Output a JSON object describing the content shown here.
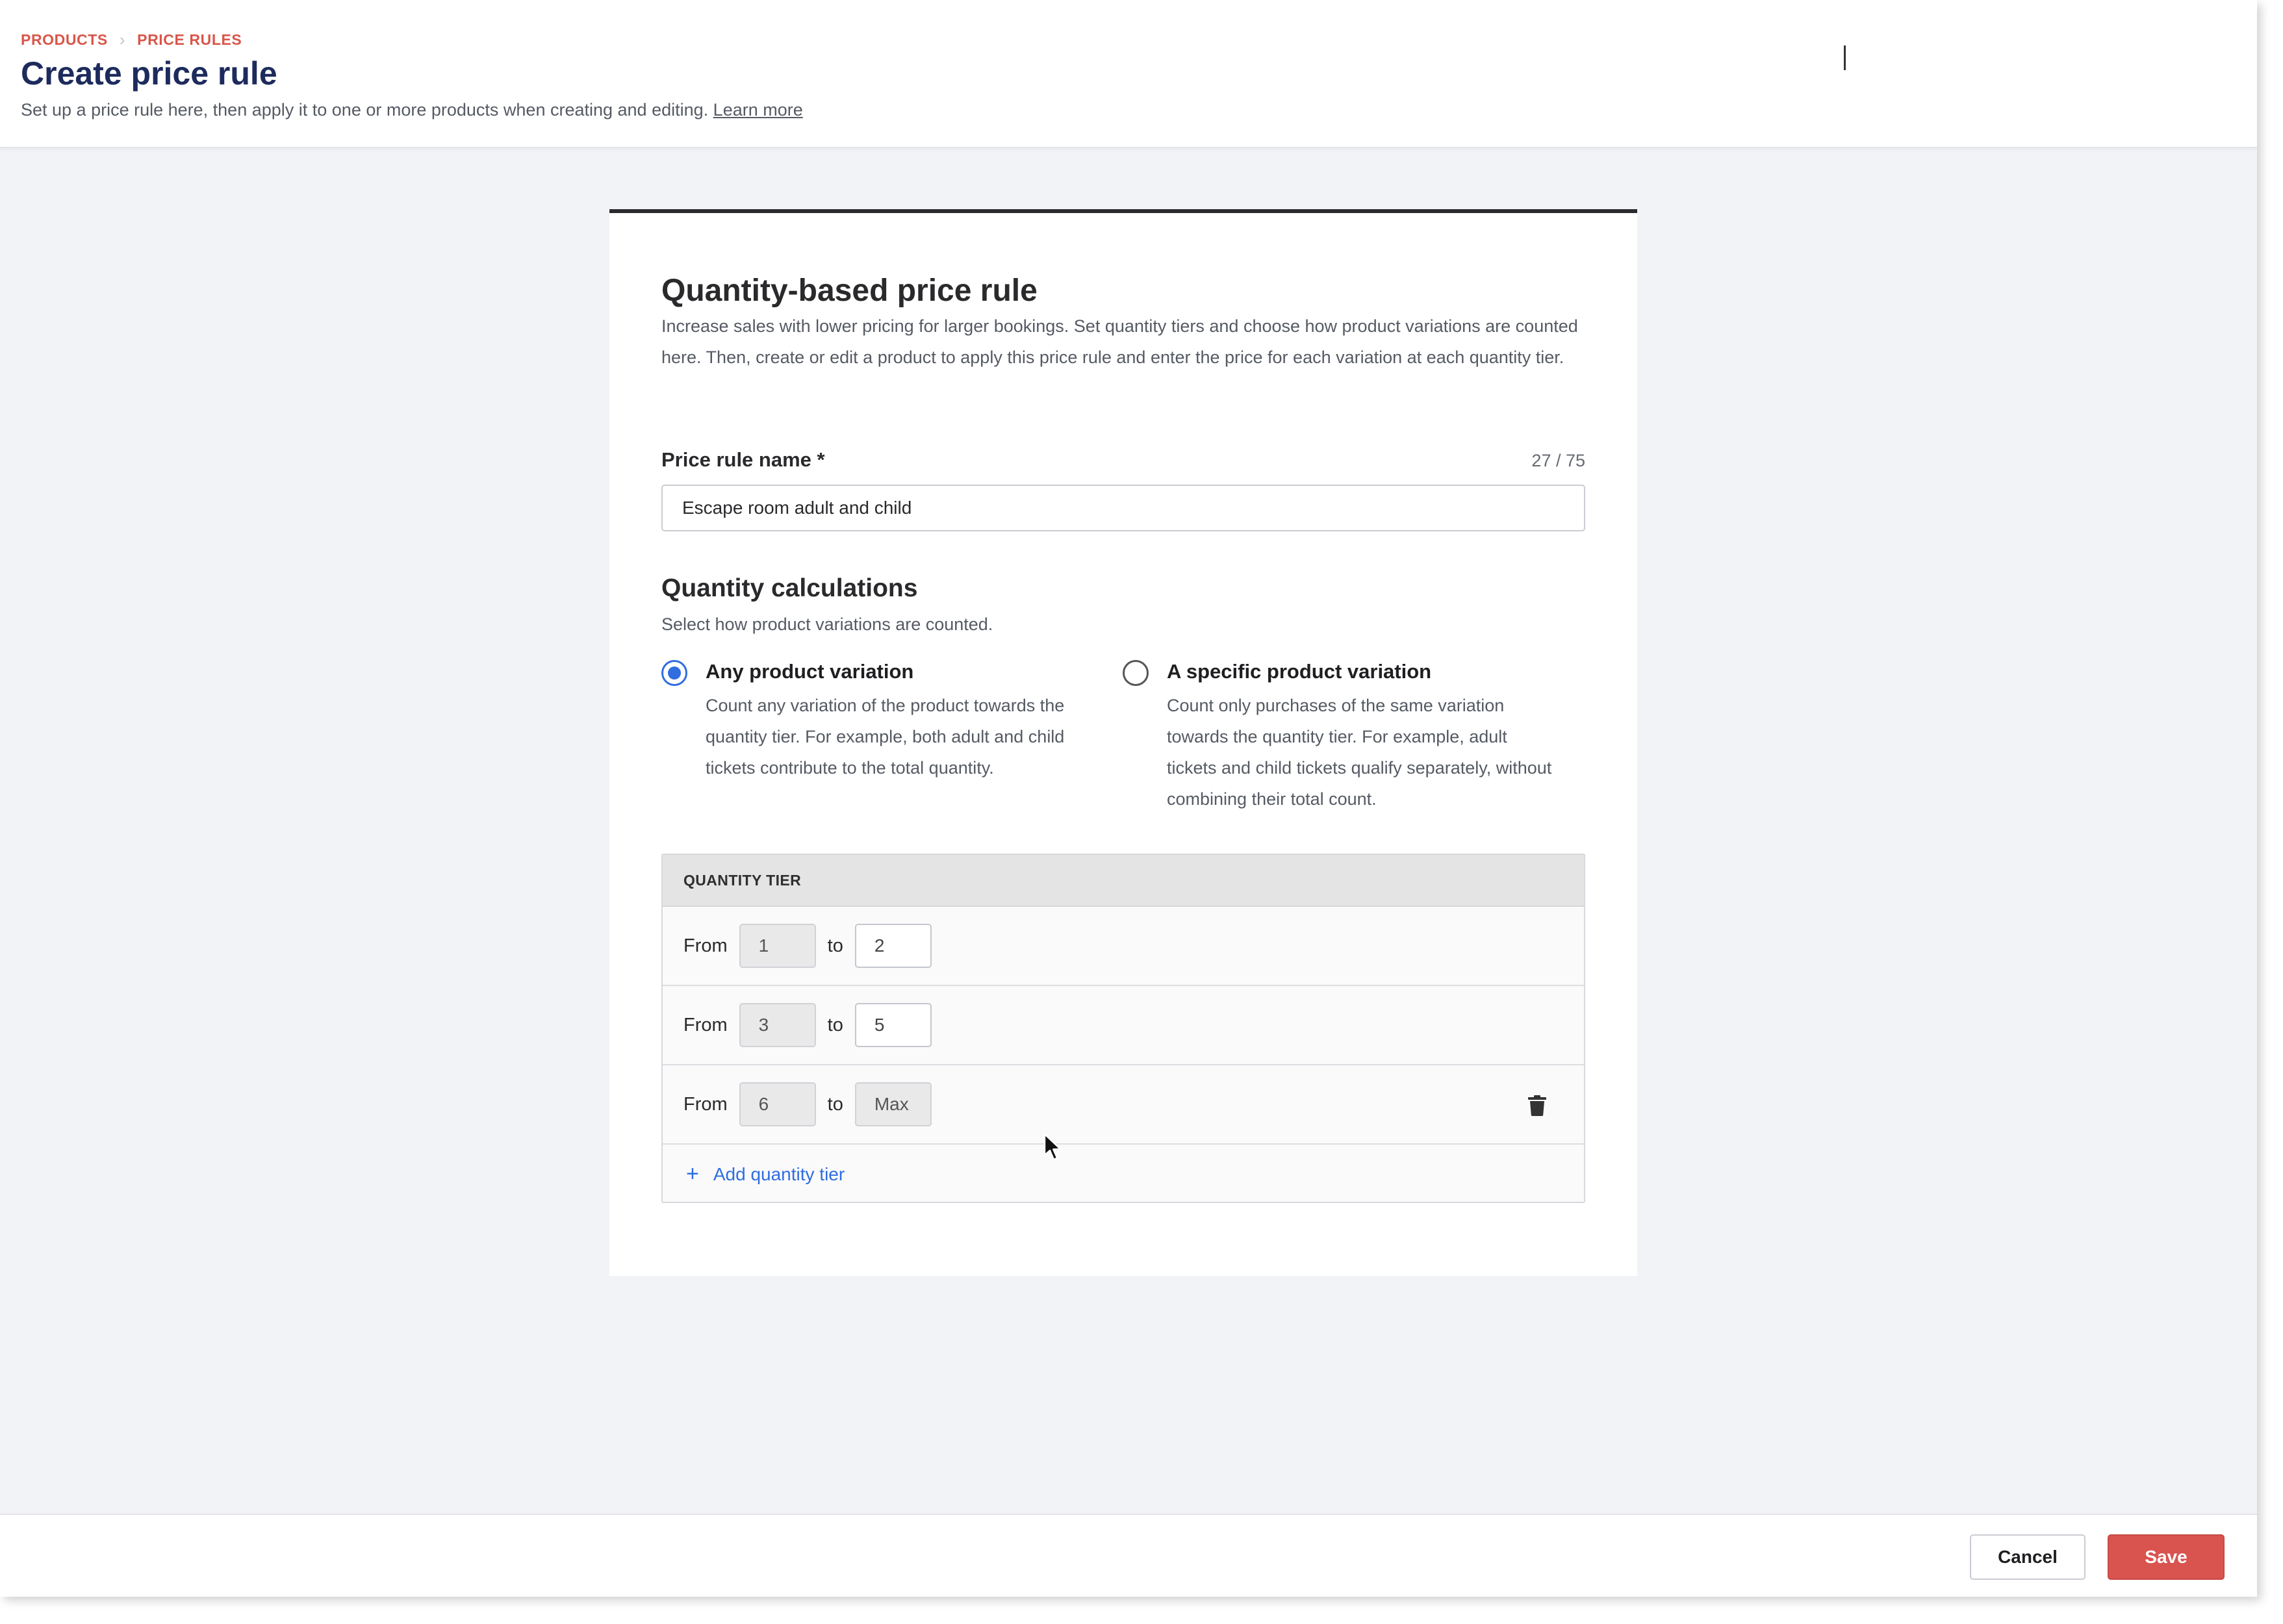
{
  "breadcrumb": {
    "items": [
      "PRODUCTS",
      "PRICE RULES"
    ],
    "separator": "›"
  },
  "header": {
    "title": "Create price rule",
    "subtitle": "Set up a price rule here, then apply it to one or more products when creating and editing.",
    "learn_more": "Learn more"
  },
  "card": {
    "title": "Quantity-based price rule",
    "description": "Increase sales with lower pricing for larger bookings. Set quantity tiers and choose how product variations are counted here. Then, create or edit a product to apply this price rule and enter the price for each variation at each quantity tier."
  },
  "price_rule_name": {
    "label": "Price rule name *",
    "char_count": "27 / 75",
    "value": "Escape room adult and child"
  },
  "quantity_calculations": {
    "title": "Quantity calculations",
    "description": "Select how product variations are counted.",
    "options": [
      {
        "label": "Any product variation",
        "description": "Count any variation of the product towards the quantity tier. For example, both adult and child tickets contribute to the total quantity.",
        "selected": true
      },
      {
        "label": "A specific product variation",
        "description": "Count only purchases of the same variation towards the quantity tier. For example, adult tickets and child tickets qualify separately, without combining their total count.",
        "selected": false
      }
    ]
  },
  "tiers": {
    "header": "QUANTITY TIER",
    "from_label": "From",
    "to_label": "to",
    "rows": [
      {
        "from": "1",
        "to": "2"
      },
      {
        "from": "3",
        "to": "5"
      },
      {
        "from": "6",
        "to": "Max"
      }
    ],
    "add_label": "Add quantity tier"
  },
  "footer": {
    "cancel": "Cancel",
    "save": "Save"
  },
  "colors": {
    "accent": "#2f6de1",
    "brand_red": "#d9534f",
    "breadcrumb": "#d9564a",
    "title_navy": "#1d2b5c"
  }
}
